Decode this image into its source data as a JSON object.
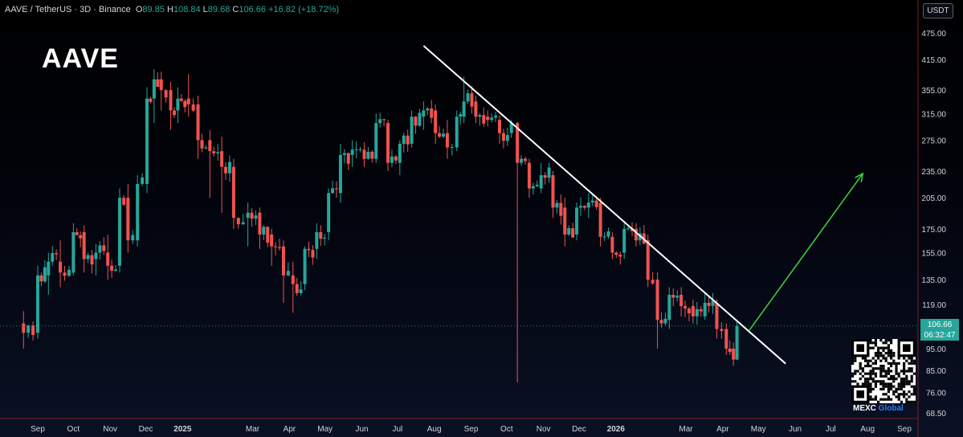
{
  "header": {
    "symbol": "AAVE / TetherUS · 3D · Binance",
    "o_label": "O",
    "o_value": "89.85",
    "h_label": "H",
    "h_value": "108.84",
    "l_label": "L",
    "l_value": "89.68",
    "c_label": "C",
    "c_value": "106.66",
    "change": "+16.82 (+18.72%)"
  },
  "title": "AAVE",
  "currency_button": "USDT",
  "price_tag": {
    "price": "106.66",
    "countdown": "06:32:47"
  },
  "brand": {
    "prefix": "MEXC",
    "suffix": " Global"
  },
  "colors": {
    "up": "#26a69a",
    "down": "#ef5350",
    "trendline": "#ffffff",
    "arrow": "#3fd33f",
    "axis_text": "#d1d4dc"
  },
  "chart_data": {
    "type": "candlestick",
    "interval": "3D",
    "y_scale": "log",
    "ylim": [
      68.5,
      500
    ],
    "y_ticks": [
      475.0,
      415.0,
      355.0,
      315.0,
      275.0,
      235.0,
      205.0,
      175.0,
      155.0,
      135.0,
      119.0,
      95.0,
      85.0,
      76.0,
      68.5
    ],
    "x_ticks": [
      "Sep",
      "Oct",
      "Nov",
      "Dec",
      "2025",
      "Mar",
      "Apr",
      "May",
      "Jun",
      "Jul",
      "Aug",
      "Sep",
      "Oct",
      "Nov",
      "Dec",
      "2026",
      "Mar",
      "Apr",
      "May",
      "Jun",
      "Jul",
      "Aug",
      "Sep"
    ],
    "last_price": 106.66,
    "series": [
      {
        "values": [
          {
            "d": "2024-08-20",
            "o": 108,
            "h": 115,
            "l": 95,
            "c": 103
          },
          {
            "d": "2024-09-01",
            "o": 103,
            "h": 145,
            "l": 100,
            "c": 138
          },
          {
            "d": "2024-09-10",
            "o": 138,
            "h": 155,
            "l": 125,
            "c": 148
          },
          {
            "d": "2024-09-20",
            "o": 148,
            "h": 165,
            "l": 130,
            "c": 140
          },
          {
            "d": "2024-10-01",
            "o": 140,
            "h": 180,
            "l": 138,
            "c": 172
          },
          {
            "d": "2024-10-10",
            "o": 172,
            "h": 178,
            "l": 140,
            "c": 150
          },
          {
            "d": "2024-10-20",
            "o": 150,
            "h": 162,
            "l": 138,
            "c": 155
          },
          {
            "d": "2024-10-30",
            "o": 155,
            "h": 170,
            "l": 135,
            "c": 145
          },
          {
            "d": "2024-11-09",
            "o": 145,
            "h": 215,
            "l": 140,
            "c": 205
          },
          {
            "d": "2024-11-16",
            "o": 205,
            "h": 220,
            "l": 155,
            "c": 165
          },
          {
            "d": "2024-11-24",
            "o": 165,
            "h": 230,
            "l": 160,
            "c": 220
          },
          {
            "d": "2024-12-02",
            "o": 220,
            "h": 360,
            "l": 210,
            "c": 340
          },
          {
            "d": "2024-12-08",
            "o": 340,
            "h": 395,
            "l": 300,
            "c": 375
          },
          {
            "d": "2024-12-14",
            "o": 375,
            "h": 390,
            "l": 320,
            "c": 355
          },
          {
            "d": "2024-12-22",
            "o": 355,
            "h": 370,
            "l": 290,
            "c": 320
          },
          {
            "d": "2024-12-28",
            "o": 320,
            "h": 360,
            "l": 300,
            "c": 340
          },
          {
            "d": "2025-01-06",
            "o": 340,
            "h": 385,
            "l": 310,
            "c": 330
          },
          {
            "d": "2025-01-14",
            "o": 330,
            "h": 345,
            "l": 250,
            "c": 275
          },
          {
            "d": "2025-01-24",
            "o": 275,
            "h": 290,
            "l": 205,
            "c": 260
          },
          {
            "d": "2025-02-03",
            "o": 260,
            "h": 280,
            "l": 190,
            "c": 240
          },
          {
            "d": "2025-02-13",
            "o": 240,
            "h": 250,
            "l": 175,
            "c": 185
          },
          {
            "d": "2025-02-25",
            "o": 185,
            "h": 200,
            "l": 160,
            "c": 190
          },
          {
            "d": "2025-03-07",
            "o": 190,
            "h": 195,
            "l": 158,
            "c": 170
          },
          {
            "d": "2025-03-17",
            "o": 170,
            "h": 175,
            "l": 145,
            "c": 160
          },
          {
            "d": "2025-03-27",
            "o": 160,
            "h": 165,
            "l": 120,
            "c": 138
          },
          {
            "d": "2025-04-04",
            "o": 138,
            "h": 148,
            "l": 114,
            "c": 132
          },
          {
            "d": "2025-04-14",
            "o": 132,
            "h": 160,
            "l": 128,
            "c": 158
          },
          {
            "d": "2025-04-24",
            "o": 158,
            "h": 180,
            "l": 150,
            "c": 172
          },
          {
            "d": "2025-05-04",
            "o": 172,
            "h": 215,
            "l": 165,
            "c": 210
          },
          {
            "d": "2025-05-14",
            "o": 210,
            "h": 270,
            "l": 200,
            "c": 255
          },
          {
            "d": "2025-05-24",
            "o": 255,
            "h": 275,
            "l": 240,
            "c": 262
          },
          {
            "d": "2025-06-03",
            "o": 262,
            "h": 272,
            "l": 240,
            "c": 250
          },
          {
            "d": "2025-06-13",
            "o": 250,
            "h": 315,
            "l": 245,
            "c": 300
          },
          {
            "d": "2025-06-23",
            "o": 300,
            "h": 305,
            "l": 235,
            "c": 245
          },
          {
            "d": "2025-07-03",
            "o": 245,
            "h": 275,
            "l": 230,
            "c": 270
          },
          {
            "d": "2025-07-13",
            "o": 270,
            "h": 320,
            "l": 265,
            "c": 310
          },
          {
            "d": "2025-07-23",
            "o": 310,
            "h": 335,
            "l": 290,
            "c": 320
          },
          {
            "d": "2025-08-02",
            "o": 320,
            "h": 330,
            "l": 270,
            "c": 285
          },
          {
            "d": "2025-08-12",
            "o": 285,
            "h": 305,
            "l": 250,
            "c": 265
          },
          {
            "d": "2025-08-20",
            "o": 265,
            "h": 320,
            "l": 260,
            "c": 310
          },
          {
            "d": "2025-08-26",
            "o": 310,
            "h": 380,
            "l": 300,
            "c": 335
          },
          {
            "d": "2025-09-05",
            "o": 335,
            "h": 345,
            "l": 300,
            "c": 310
          },
          {
            "d": "2025-09-15",
            "o": 310,
            "h": 320,
            "l": 295,
            "c": 305
          },
          {
            "d": "2025-09-25",
            "o": 305,
            "h": 312,
            "l": 270,
            "c": 285
          },
          {
            "d": "2025-10-05",
            "o": 285,
            "h": 305,
            "l": 278,
            "c": 300
          },
          {
            "d": "2025-10-10",
            "o": 300,
            "h": 302,
            "l": 80,
            "c": 245
          },
          {
            "d": "2025-10-20",
            "o": 245,
            "h": 250,
            "l": 205,
            "c": 215
          },
          {
            "d": "2025-10-30",
            "o": 215,
            "h": 245,
            "l": 210,
            "c": 230
          },
          {
            "d": "2025-11-09",
            "o": 230,
            "h": 235,
            "l": 185,
            "c": 195
          },
          {
            "d": "2025-11-19",
            "o": 195,
            "h": 205,
            "l": 160,
            "c": 170
          },
          {
            "d": "2025-11-29",
            "o": 170,
            "h": 200,
            "l": 165,
            "c": 195
          },
          {
            "d": "2025-12-09",
            "o": 195,
            "h": 210,
            "l": 185,
            "c": 200
          },
          {
            "d": "2025-12-19",
            "o": 200,
            "h": 205,
            "l": 160,
            "c": 168
          },
          {
            "d": "2025-12-29",
            "o": 168,
            "h": 172,
            "l": 150,
            "c": 155
          },
          {
            "d": "2026-01-08",
            "o": 155,
            "h": 180,
            "l": 150,
            "c": 175
          },
          {
            "d": "2026-01-18",
            "o": 175,
            "h": 180,
            "l": 160,
            "c": 165
          },
          {
            "d": "2026-01-28",
            "o": 165,
            "h": 170,
            "l": 130,
            "c": 135
          },
          {
            "d": "2026-02-05",
            "o": 135,
            "h": 140,
            "l": 95,
            "c": 110
          },
          {
            "d": "2026-02-15",
            "o": 110,
            "h": 130,
            "l": 105,
            "c": 125
          },
          {
            "d": "2026-02-25",
            "o": 125,
            "h": 130,
            "l": 112,
            "c": 118
          },
          {
            "d": "2026-03-07",
            "o": 118,
            "h": 122,
            "l": 108,
            "c": 112
          },
          {
            "d": "2026-03-17",
            "o": 112,
            "h": 127,
            "l": 110,
            "c": 120
          },
          {
            "d": "2026-03-27",
            "o": 120,
            "h": 122,
            "l": 100,
            "c": 105
          },
          {
            "d": "2026-04-04",
            "o": 105,
            "h": 108,
            "l": 92,
            "c": 95
          },
          {
            "d": "2026-04-10",
            "o": 95,
            "h": 98,
            "l": 87,
            "c": 89.85
          },
          {
            "d": "2026-04-13",
            "o": 89.85,
            "h": 108.84,
            "l": 89.68,
            "c": 106.66
          }
        ]
      }
    ],
    "trendline": {
      "from": {
        "d": "2025-07-23",
        "p": 445
      },
      "to": {
        "d": "2026-05-24",
        "p": 88
      }
    },
    "arrow": {
      "from": {
        "d": "2026-04-23",
        "p": 104
      },
      "to": {
        "d": "2026-07-28",
        "p": 232
      }
    }
  }
}
